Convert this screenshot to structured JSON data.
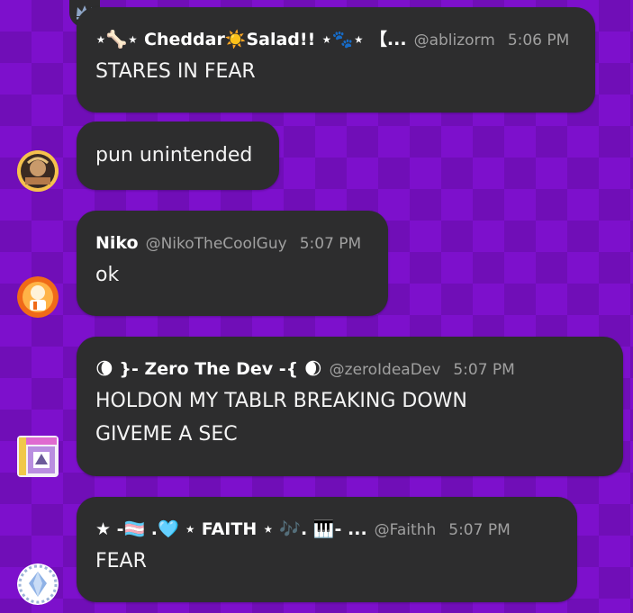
{
  "messages": [
    {
      "display_name": "⋆🦴⋆ Cheddar☀️Salad!! ⋆🐾⋆ 【...",
      "handle": "@ablizorm",
      "time": "5:06 PM",
      "lines": [
        "STARES IN FEAR"
      ]
    },
    {
      "lines": [
        "pun unintended"
      ]
    },
    {
      "display_name": "Niko",
      "handle": "@NikoTheCoolGuy",
      "time": "5:07 PM",
      "lines": [
        "ok"
      ]
    },
    {
      "display_name": "🌘 }- Zero The Dev -{ 🌒",
      "handle": "@zeroIdeaDev",
      "time": "5:07 PM",
      "lines": [
        "HOLDON MY TABLR BREAKING DOWN",
        "GIVEME A SEC"
      ]
    },
    {
      "display_name": "★ -🏳️‍⚧️ .🩵 ⋆ FAITH ⋆ 🎶. 🎹- ...",
      "handle": "@Faithh",
      "time": "5:07 PM",
      "lines": [
        "FEAR"
      ]
    }
  ],
  "icons": {
    "badge": "crown-icon"
  },
  "colors": {
    "background": "#7d10cc",
    "bubble": "#2d2d2e",
    "muted_text": "#a0a0a0"
  }
}
